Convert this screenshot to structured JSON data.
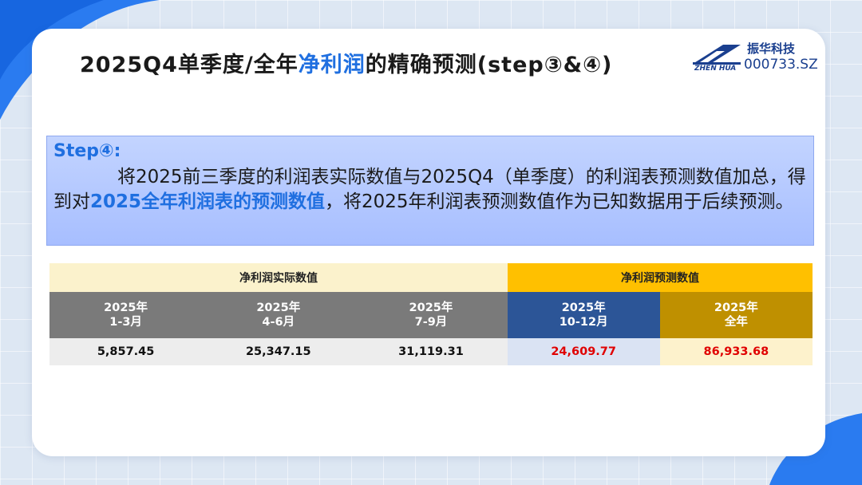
{
  "slide": {
    "title_prefix": "2025Q4单季度/全年",
    "title_highlight": "净利润",
    "title_suffix": "的精确预测(step③&④)"
  },
  "logo": {
    "name_cn": "振华科技",
    "name_en": "ZHEN HUA",
    "stock_code": "000733.SZ",
    "brand_color": "#1a3f8f"
  },
  "step": {
    "label": "Step④:",
    "text_part1": "将2025前三季度的利润表实际数值与2025Q4（单季度）的利润表预测数值加总，得到对",
    "text_highlight": "2025全年利润表的预测数值",
    "text_part2": "，将2025年利润表预测数值作为已知数据用于后续预测。"
  },
  "table": {
    "group_actual": "净利润实际数值",
    "group_forecast": "净利润预测数值",
    "columns": [
      {
        "line1": "2025年",
        "line2": "1-3月"
      },
      {
        "line1": "2025年",
        "line2": "4-6月"
      },
      {
        "line1": "2025年",
        "line2": "7-9月"
      },
      {
        "line1": "2025年",
        "line2": "10-12月"
      },
      {
        "line1": "2025年",
        "line2": "全年"
      }
    ],
    "values": [
      "5,857.45",
      "25,347.15",
      "31,119.31",
      "24,609.77",
      "86,933.68"
    ],
    "colors": {
      "actual_header": "#7a7a7a",
      "q4_header": "#2c5597",
      "year_header": "#bf9000",
      "forecast_value": "#e00000",
      "highlight_text": "#1f6fe0"
    }
  }
}
